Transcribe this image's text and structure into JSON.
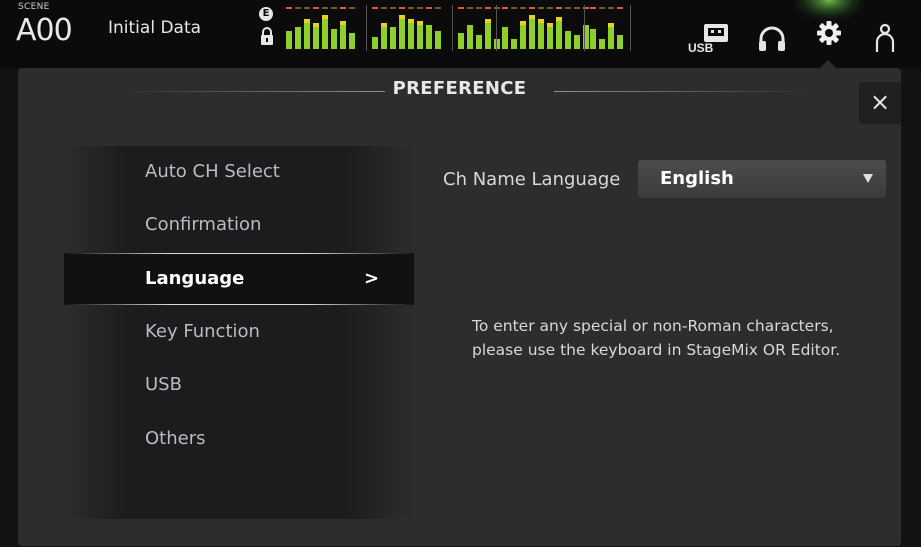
{
  "header": {
    "scene_label": "SCENE",
    "scene_number": "A00",
    "scene_title": "Initial Data",
    "e_badge": "E",
    "icons": [
      "lock-icon",
      "usb-icon",
      "headphones-icon",
      "gear-icon",
      "user-icon"
    ],
    "usb_label": "USB"
  },
  "panel": {
    "title": "PREFERENCE",
    "close_label": "×"
  },
  "menu": {
    "items": [
      {
        "label": "Auto CH Select"
      },
      {
        "label": "Confirmation"
      },
      {
        "label": "Language",
        "chevron": ">"
      },
      {
        "label": "Key Function"
      },
      {
        "label": "USB"
      },
      {
        "label": "Others"
      }
    ],
    "selected_index": 2
  },
  "language": {
    "field_label": "Ch Name Language",
    "selected_value": "English",
    "hint_line1": "To enter any special or non-Roman characters,",
    "hint_line2": "please use the keyboard in StageMix OR Editor."
  },
  "colors": {
    "meter_green": "#8ecf2c",
    "meter_yellow": "#e8d21c",
    "meter_red": "#e05a2a",
    "gear_glow": "#7cd35a"
  }
}
